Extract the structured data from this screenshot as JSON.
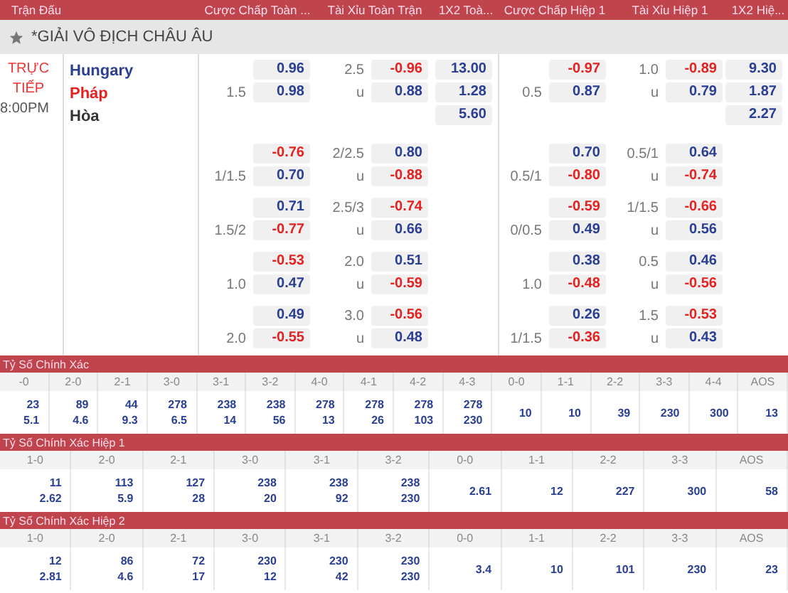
{
  "header": {
    "columns": [
      "Trận Đấu",
      "Cược Chấp Toàn ...",
      "Tài Xỉu Toàn Trận",
      "1X2 Toà...",
      "Cược Chấp Hiệp 1",
      "Tài Xỉu Hiệp 1",
      "1X2 Hiệ..."
    ]
  },
  "league": {
    "name": "*GIẢI VÔ ĐỊCH CHÂU ÂU"
  },
  "match": {
    "status": "TRỰC TIẾP",
    "time": "8:00PM",
    "teams": [
      {
        "name": "Hungary",
        "kind": "home"
      },
      {
        "name": "Pháp",
        "kind": "away"
      },
      {
        "name": "Hòa",
        "kind": "draw"
      }
    ],
    "odds_rows": [
      {
        "markets": [
          {
            "kind": "pair",
            "top": {
              "value": "0.96",
              "negative": false
            },
            "bottom_label": "1.5",
            "bottom": {
              "value": "0.98",
              "negative": false
            }
          },
          {
            "kind": "pair",
            "top_label": "2.5",
            "top": {
              "value": "-0.96",
              "negative": true
            },
            "bottom_label": "u",
            "bottom": {
              "value": "0.88",
              "negative": false
            }
          },
          {
            "kind": "triple",
            "values": [
              "13.00",
              "1.28",
              "5.60"
            ]
          },
          {
            "kind": "pair",
            "top": {
              "value": "-0.97",
              "negative": true
            },
            "bottom_label": "0.5",
            "bottom": {
              "value": "0.87",
              "negative": false
            }
          },
          {
            "kind": "pair",
            "top_label": "1.0",
            "top": {
              "value": "-0.89",
              "negative": true
            },
            "bottom_label": "u",
            "bottom": {
              "value": "0.79",
              "negative": false
            }
          },
          {
            "kind": "triple",
            "values": [
              "9.30",
              "1.87",
              "2.27"
            ]
          }
        ]
      },
      {
        "markets": [
          {
            "kind": "pair",
            "top": {
              "value": "-0.76",
              "negative": true
            },
            "bottom_label": "1/1.5",
            "bottom": {
              "value": "0.70",
              "negative": false
            }
          },
          {
            "kind": "pair",
            "top_label": "2/2.5",
            "top": {
              "value": "0.80",
              "negative": false
            },
            "bottom_label": "u",
            "bottom": {
              "value": "-0.88",
              "negative": true
            }
          },
          {
            "kind": "triple"
          },
          {
            "kind": "pair",
            "top": {
              "value": "0.70",
              "negative": false
            },
            "bottom_label": "0.5/1",
            "bottom": {
              "value": "-0.80",
              "negative": true
            }
          },
          {
            "kind": "pair",
            "top_label": "0.5/1",
            "top": {
              "value": "0.64",
              "negative": false
            },
            "bottom_label": "u",
            "bottom": {
              "value": "-0.74",
              "negative": true
            }
          },
          {
            "kind": "triple"
          }
        ]
      },
      {
        "markets": [
          {
            "kind": "pair",
            "top": {
              "value": "0.71",
              "negative": false
            },
            "bottom_label": "1.5/2",
            "bottom": {
              "value": "-0.77",
              "negative": true
            }
          },
          {
            "kind": "pair",
            "top_label": "2.5/3",
            "top": {
              "value": "-0.74",
              "negative": true
            },
            "bottom_label": "u",
            "bottom": {
              "value": "0.66",
              "negative": false
            }
          },
          {
            "kind": "triple"
          },
          {
            "kind": "pair",
            "top": {
              "value": "-0.59",
              "negative": true
            },
            "bottom_label": "0/0.5",
            "bottom": {
              "value": "0.49",
              "negative": false
            }
          },
          {
            "kind": "pair",
            "top_label": "1/1.5",
            "top": {
              "value": "-0.66",
              "negative": true
            },
            "bottom_label": "u",
            "bottom": {
              "value": "0.56",
              "negative": false
            }
          },
          {
            "kind": "triple"
          }
        ]
      },
      {
        "markets": [
          {
            "kind": "pair",
            "top": {
              "value": "-0.53",
              "negative": true
            },
            "bottom_label": "1.0",
            "bottom": {
              "value": "0.47",
              "negative": false
            }
          },
          {
            "kind": "pair",
            "top_label": "2.0",
            "top": {
              "value": "0.51",
              "negative": false
            },
            "bottom_label": "u",
            "bottom": {
              "value": "-0.59",
              "negative": true
            }
          },
          {
            "kind": "triple"
          },
          {
            "kind": "pair",
            "top": {
              "value": "0.38",
              "negative": false
            },
            "bottom_label": "1.0",
            "bottom": {
              "value": "-0.48",
              "negative": true
            }
          },
          {
            "kind": "pair",
            "top_label": "0.5",
            "top": {
              "value": "0.46",
              "negative": false
            },
            "bottom_label": "u",
            "bottom": {
              "value": "-0.56",
              "negative": true
            }
          },
          {
            "kind": "triple"
          }
        ]
      },
      {
        "markets": [
          {
            "kind": "pair",
            "top": {
              "value": "0.49",
              "negative": false
            },
            "bottom_label": "2.0",
            "bottom": {
              "value": "-0.55",
              "negative": true
            }
          },
          {
            "kind": "pair",
            "top_label": "3.0",
            "top": {
              "value": "-0.56",
              "negative": true
            },
            "bottom_label": "u",
            "bottom": {
              "value": "0.48",
              "negative": false
            }
          },
          {
            "kind": "triple"
          },
          {
            "kind": "pair",
            "top": {
              "value": "0.26",
              "negative": false
            },
            "bottom_label": "1/1.5",
            "bottom": {
              "value": "-0.36",
              "negative": true
            }
          },
          {
            "kind": "pair",
            "top_label": "1.5",
            "top": {
              "value": "-0.53",
              "negative": true
            },
            "bottom_label": "u",
            "bottom": {
              "value": "0.43",
              "negative": false
            }
          },
          {
            "kind": "triple"
          }
        ]
      }
    ]
  },
  "score_sections": [
    {
      "title": "Tỷ Số Chính Xác",
      "columns": [
        {
          "score": "-0",
          "values": [
            "23",
            "5.1"
          ]
        },
        {
          "score": "2-0",
          "values": [
            "89",
            "4.6"
          ]
        },
        {
          "score": "2-1",
          "values": [
            "44",
            "9.3"
          ]
        },
        {
          "score": "3-0",
          "values": [
            "278",
            "6.5"
          ]
        },
        {
          "score": "3-1",
          "values": [
            "238",
            "14"
          ]
        },
        {
          "score": "3-2",
          "values": [
            "238",
            "56"
          ]
        },
        {
          "score": "4-0",
          "values": [
            "278",
            "13"
          ]
        },
        {
          "score": "4-1",
          "values": [
            "278",
            "26"
          ]
        },
        {
          "score": "4-2",
          "values": [
            "278",
            "103"
          ]
        },
        {
          "score": "4-3",
          "values": [
            "278",
            "230"
          ]
        },
        {
          "score": "0-0",
          "values": [
            "10"
          ]
        },
        {
          "score": "1-1",
          "values": [
            "10"
          ]
        },
        {
          "score": "2-2",
          "values": [
            "39"
          ]
        },
        {
          "score": "3-3",
          "values": [
            "230"
          ]
        },
        {
          "score": "4-4",
          "values": [
            "300"
          ]
        },
        {
          "score": "AOS",
          "values": [
            "13"
          ]
        }
      ]
    },
    {
      "title": "Tỷ Số Chính Xác Hiệp 1",
      "columns": [
        {
          "score": "1-0",
          "values": [
            "11",
            "2.62"
          ]
        },
        {
          "score": "2-0",
          "values": [
            "113",
            "5.9"
          ]
        },
        {
          "score": "2-1",
          "values": [
            "127",
            "28"
          ]
        },
        {
          "score": "3-0",
          "values": [
            "238",
            "20"
          ]
        },
        {
          "score": "3-1",
          "values": [
            "238",
            "92"
          ]
        },
        {
          "score": "3-2",
          "values": [
            "238",
            "230"
          ]
        },
        {
          "score": "0-0",
          "values": [
            "2.61"
          ]
        },
        {
          "score": "1-1",
          "values": [
            "12"
          ]
        },
        {
          "score": "2-2",
          "values": [
            "227"
          ]
        },
        {
          "score": "3-3",
          "values": [
            "300"
          ]
        },
        {
          "score": "AOS",
          "values": [
            "58"
          ]
        }
      ]
    },
    {
      "title": "Tỷ Số Chính Xác Hiệp 2",
      "columns": [
        {
          "score": "1-0",
          "values": [
            "12",
            "2.81"
          ]
        },
        {
          "score": "2-0",
          "values": [
            "86",
            "4.6"
          ]
        },
        {
          "score": "2-1",
          "values": [
            "72",
            "17"
          ]
        },
        {
          "score": "3-0",
          "values": [
            "230",
            "12"
          ]
        },
        {
          "score": "3-1",
          "values": [
            "230",
            "42"
          ]
        },
        {
          "score": "3-2",
          "values": [
            "230",
            "230"
          ]
        },
        {
          "score": "0-0",
          "values": [
            "3.4"
          ]
        },
        {
          "score": "1-1",
          "values": [
            "10"
          ]
        },
        {
          "score": "2-2",
          "values": [
            "101"
          ]
        },
        {
          "score": "3-3",
          "values": [
            "230"
          ]
        },
        {
          "score": "AOS",
          "values": [
            "23"
          ]
        }
      ]
    }
  ]
}
